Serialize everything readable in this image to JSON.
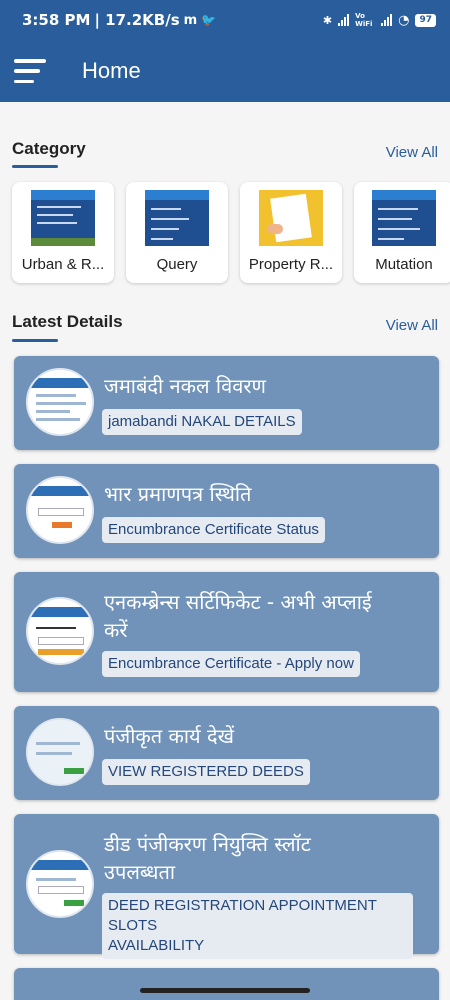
{
  "status_bar": {
    "time": "3:58 PM",
    "speed": "| 17.2KB/s",
    "network1": "Vo WiFi",
    "battery": "97"
  },
  "app_bar": {
    "title": "Home"
  },
  "category": {
    "title": "Category",
    "view_all": "View All",
    "items": [
      {
        "label": "Urban & R...",
        "icon": "urban-rural-records-thumbnail"
      },
      {
        "label": "Query",
        "icon": "query-menu-thumbnail"
      },
      {
        "label": "Property R...",
        "icon": "property-registration-thumbnail"
      },
      {
        "label": "Mutation",
        "icon": "mutation-menu-thumbnail"
      }
    ]
  },
  "latest": {
    "title": "Latest Details",
    "view_all": "View All",
    "items": [
      {
        "hindi": "जमाबंदी नकल विवरण",
        "english": "jamabandi NAKAL DETAILS"
      },
      {
        "hindi": "भार प्रमाणपत्र स्थिति",
        "english": "Encumbrance Certificate Status"
      },
      {
        "hindi_line1": "एनकम्ब्रेन्स सर्टिफिकेट - अभी अप्लाई",
        "hindi_line2": "करें",
        "english": "Encumbrance Certificate -  Apply now"
      },
      {
        "hindi": "पंजीकृत कार्य देखें",
        "english": "VIEW REGISTERED DEEDS"
      },
      {
        "hindi_line1": "डीड पंजीकरण नियुक्ति स्लॉट",
        "hindi_line2": "उपलब्धता",
        "english_line1": "DEED REGISTRATION APPOINTMENT SLOTS",
        "english_line2": "AVAILABILITY"
      }
    ]
  },
  "colors": {
    "primary": "#2a5d9c",
    "card": "#7193b9",
    "tag_bg": "#e6ebf2"
  }
}
